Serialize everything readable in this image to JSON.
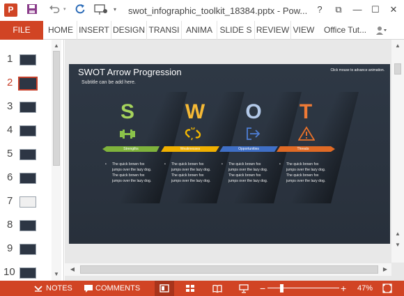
{
  "app": {
    "logo_letter": "P",
    "document_title": "swot_infographic_toolkit_18384.pptx - Pow...",
    "window_controls": {
      "help": "?",
      "restore": "⧉",
      "minimize": "—",
      "maximize": "☐",
      "close": "✕"
    }
  },
  "quick_access": {
    "icons": [
      "save-icon",
      "undo-icon",
      "refresh-icon",
      "present-icon"
    ],
    "customize_glyph": "▾",
    "undo_caret": "▾"
  },
  "ribbon": {
    "file_label": "FILE",
    "tabs": [
      "HOME",
      "INSERT",
      "DESIGN",
      "TRANSI",
      "ANIMA",
      "SLIDE S",
      "REVIEW",
      "VIEW"
    ],
    "account_label": "Office Tut...",
    "account_caret": "▾"
  },
  "thumbnails": {
    "slide_numbers": [
      "1",
      "2",
      "3",
      "4",
      "5",
      "6",
      "7",
      "8",
      "9",
      "10"
    ],
    "selected_index": 2
  },
  "slide": {
    "title": "SWOT Arrow Progression",
    "subtitle": "Subtitle can be add here.",
    "hint": "Click mouse to advance animation.",
    "items": [
      {
        "letter": "S",
        "label": "Strengths",
        "color": "#8bc34a",
        "body": "The quick brown fox jumps over the lazy dog. The quick brown fox jumps over the lazy dog.",
        "icon": "dumbbell-icon"
      },
      {
        "letter": "W",
        "label": "Weaknesses",
        "color": "#f5b800",
        "body": "The quick brown fox jumps over the lazy dog. The quick brown fox jumps over the lazy dog.",
        "icon": "broken-chain-icon"
      },
      {
        "letter": "O",
        "label": "Opportunities",
        "color": "#4f7fd6",
        "body": "The quick brown fox jumps over the lazy dog. The quick brown fox jumps over the lazy dog.",
        "icon": "exit-arrow-icon"
      },
      {
        "letter": "T",
        "label": "Threats",
        "color": "#e8712a",
        "body": "The quick brown fox jumps over the lazy dog. The quick brown fox jumps over the lazy dog.",
        "icon": "warning-triangle-icon"
      }
    ]
  },
  "statusbar": {
    "notes_label": "NOTES",
    "comments_label": "COMMENTS",
    "zoom_minus": "−",
    "zoom_plus": "+",
    "zoom_percent": "47%",
    "zoom_level": 0.47
  },
  "colors": {
    "accent": "#d14424",
    "slide_bg": "#2d3644"
  }
}
